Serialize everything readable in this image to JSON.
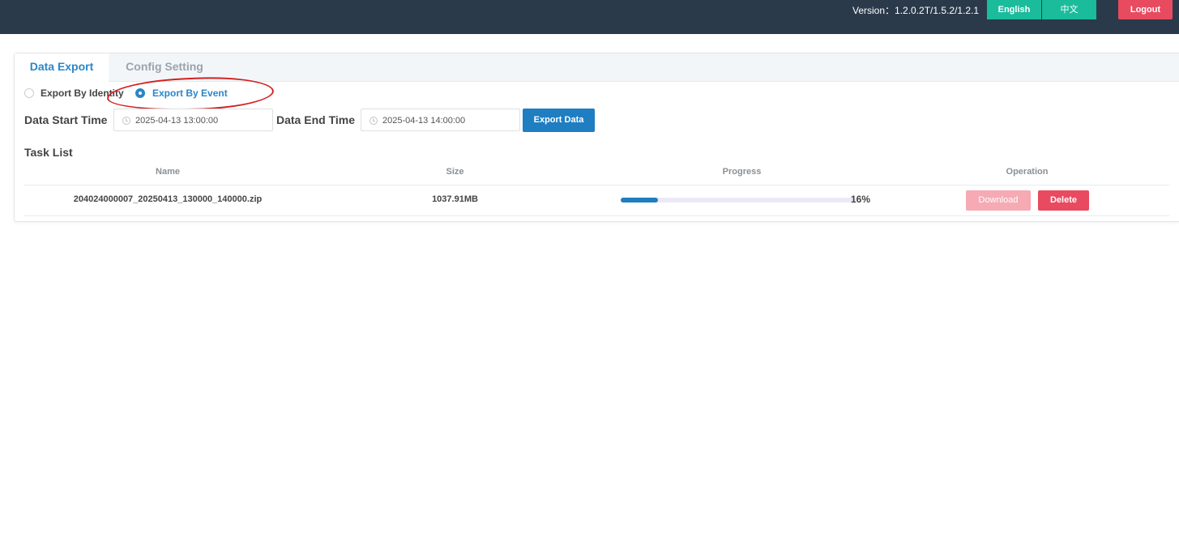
{
  "header": {
    "version_text": "Version：1.2.0.2T/1.5.2/1.2.1",
    "lang_english": "English",
    "lang_chinese": "中文",
    "logout": "Logout"
  },
  "tabs": [
    {
      "label": "Data Export",
      "active": true
    },
    {
      "label": "Config Setting",
      "active": false
    }
  ],
  "export_mode": {
    "options": [
      {
        "label": "Export By Identity",
        "checked": false
      },
      {
        "label": "Export By Event",
        "checked": true
      }
    ]
  },
  "time_range": {
    "start_label": "Data Start Time",
    "start_value": "2025-04-13 13:00:00",
    "end_label": "Data End Time",
    "end_value": "2025-04-13 14:00:00",
    "export_button": "Export Data"
  },
  "task_list": {
    "title": "Task List",
    "columns": [
      "Name",
      "Size",
      "Progress",
      "Operation"
    ],
    "rows": [
      {
        "name": "204024000007_20250413_130000_140000.zip",
        "size": "1037.91MB",
        "progress": 16,
        "progress_text": "16%",
        "download": "Download",
        "delete": "Delete"
      }
    ]
  },
  "colors": {
    "topbar": "#2b3a4a",
    "accent": "#1f7dc2",
    "lang_button": "#1abc9c",
    "danger": "#e84a5f",
    "danger_disabled": "#f5aab4",
    "annotation": "#d42020"
  },
  "icons": {
    "time_input": "clock-icon"
  }
}
